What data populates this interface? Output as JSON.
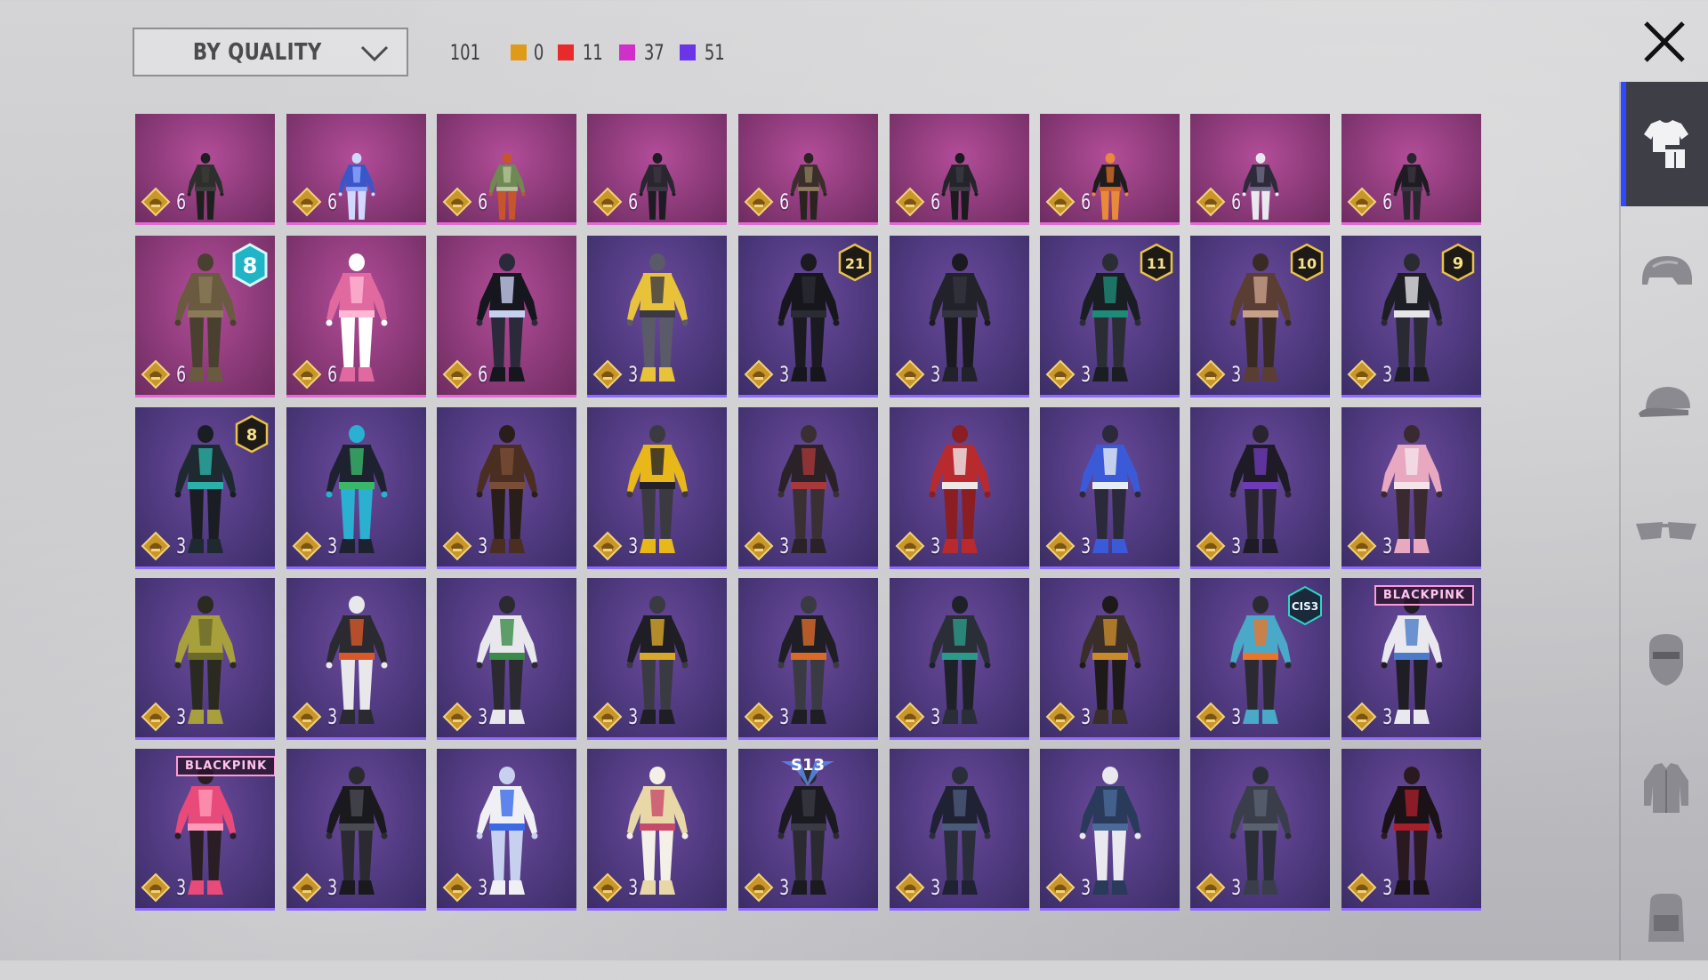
{
  "sort": {
    "label": "BY QUALITY"
  },
  "counts": {
    "total": "101",
    "items": [
      {
        "color": "#e09a1a",
        "value": "0"
      },
      {
        "color": "#e82a2a",
        "value": "11"
      },
      {
        "color": "#d12fc9",
        "value": "37"
      },
      {
        "color": "#6a35e8",
        "value": "51"
      }
    ]
  },
  "sidebar": {
    "items": [
      {
        "name": "outfit",
        "icon": "outfit-icon",
        "active": true
      },
      {
        "name": "helmet",
        "icon": "helmet-icon",
        "active": false
      },
      {
        "name": "cap",
        "icon": "cap-icon",
        "active": false
      },
      {
        "name": "glasses",
        "icon": "glasses-icon",
        "active": false
      },
      {
        "name": "mask",
        "icon": "mask-icon",
        "active": false
      },
      {
        "name": "jacket",
        "icon": "jacket-icon",
        "active": false
      },
      {
        "name": "backpack",
        "icon": "backpack-icon",
        "active": false
      }
    ]
  },
  "grid": {
    "rows": [
      [
        {
          "quality": "pink",
          "price": "6",
          "outfit": "dark-camo"
        },
        {
          "quality": "pink",
          "price": "6",
          "outfit": "blue-dancer"
        },
        {
          "quality": "pink",
          "price": "6",
          "outfit": "green-skirt"
        },
        {
          "quality": "pink",
          "price": "6",
          "outfit": "dark-coat"
        },
        {
          "quality": "pink",
          "price": "6",
          "outfit": "tan-boots"
        },
        {
          "quality": "pink",
          "price": "6",
          "outfit": "suit"
        },
        {
          "quality": "pink",
          "price": "6",
          "outfit": "orange-fox"
        },
        {
          "quality": "pink",
          "price": "6",
          "outfit": "plaid"
        },
        {
          "quality": "pink",
          "price": "6",
          "outfit": "black-trench"
        }
      ],
      [
        {
          "quality": "pink",
          "price": "6",
          "outfit": "camo-soldier",
          "badge": "8",
          "badgeStyle": "teal"
        },
        {
          "quality": "pink",
          "price": "6",
          "outfit": "pink-swim"
        },
        {
          "quality": "pink",
          "price": "6",
          "outfit": "skeleton"
        },
        {
          "quality": "purple",
          "price": "3",
          "outfit": "yellow-top"
        },
        {
          "quality": "purple",
          "price": "3",
          "outfit": "black-armor",
          "badge": "21",
          "badgeStyle": "gold"
        },
        {
          "quality": "purple",
          "price": "3",
          "outfit": "dark-dress"
        },
        {
          "quality": "purple",
          "price": "3",
          "outfit": "teal-ninja",
          "badge": "11",
          "badgeStyle": "gold"
        },
        {
          "quality": "purple",
          "price": "3",
          "outfit": "fur-coat",
          "badge": "10",
          "badgeStyle": "gold"
        },
        {
          "quality": "purple",
          "price": "3",
          "outfit": "black-white",
          "badge": "9",
          "badgeStyle": "gold"
        }
      ],
      [
        {
          "quality": "purple",
          "price": "3",
          "outfit": "teal-stealth",
          "badge": "8",
          "badgeStyle": "gold"
        },
        {
          "quality": "purple",
          "price": "3",
          "outfit": "green-cape"
        },
        {
          "quality": "purple",
          "price": "3",
          "outfit": "brown-hood"
        },
        {
          "quality": "purple",
          "price": "3",
          "outfit": "yellow-jacket"
        },
        {
          "quality": "purple",
          "price": "3",
          "outfit": "red-vest"
        },
        {
          "quality": "purple",
          "price": "3",
          "outfit": "red-white"
        },
        {
          "quality": "purple",
          "price": "3",
          "outfit": "blue-white"
        },
        {
          "quality": "purple",
          "price": "3",
          "outfit": "purple-hood"
        },
        {
          "quality": "purple",
          "price": "3",
          "outfit": "pink-skirt"
        }
      ],
      [
        {
          "quality": "purple",
          "price": "3",
          "outfit": "yellow-tactical"
        },
        {
          "quality": "purple",
          "price": "3",
          "outfit": "orange-racer"
        },
        {
          "quality": "purple",
          "price": "3",
          "outfit": "white-hoodie"
        },
        {
          "quality": "purple",
          "price": "3",
          "outfit": "yellow-black"
        },
        {
          "quality": "purple",
          "price": "3",
          "outfit": "orange-black"
        },
        {
          "quality": "purple",
          "price": "3",
          "outfit": "teal-scarf"
        },
        {
          "quality": "purple",
          "price": "3",
          "outfit": "orange-belt"
        },
        {
          "quality": "purple",
          "price": "3",
          "outfit": "orange-pants",
          "badge": "CIS3",
          "badgeStyle": "hex"
        },
        {
          "quality": "purple",
          "price": "3",
          "outfit": "blackpink-blue",
          "tag": "BLACKPINK"
        }
      ],
      [
        {
          "quality": "purple",
          "price": "3",
          "outfit": "blackpink-pink",
          "tag": "BLACKPINK"
        },
        {
          "quality": "purple",
          "price": "3",
          "outfit": "black-leather"
        },
        {
          "quality": "purple",
          "price": "3",
          "outfit": "white-blue-suit"
        },
        {
          "quality": "purple",
          "price": "3",
          "outfit": "idol-dress"
        },
        {
          "quality": "purple",
          "price": "3",
          "outfit": "s13-leather",
          "badge": "S13",
          "badgeStyle": "wing"
        },
        {
          "quality": "purple",
          "price": "3",
          "outfit": "hooded-navy"
        },
        {
          "quality": "purple",
          "price": "3",
          "outfit": "denim"
        },
        {
          "quality": "purple",
          "price": "3",
          "outfit": "grey-hood"
        },
        {
          "quality": "purple",
          "price": "3",
          "outfit": "red-black-pair"
        }
      ]
    ]
  },
  "palette": {
    "black-white": [
      "#1d1d24",
      "#e6e6ea",
      "#2a2a32"
    ],
    "black-armor": [
      "#16161c",
      "#2b2b34",
      "#1a1a20"
    ],
    "dark-camo": [
      "#2e2f2c",
      "#3a3c38",
      "#1f201e"
    ],
    "blue-dancer": [
      "#3a56c8",
      "#8fa8ff",
      "#d0d8ff"
    ],
    "green-skirt": [
      "#6e8a52",
      "#b5c49a",
      "#c7542a"
    ],
    "dark-coat": [
      "#2a2630",
      "#3b3642",
      "#1e1b22"
    ],
    "tan-boots": [
      "#3a2e2a",
      "#8c7a5a",
      "#2a2320"
    ],
    "suit": [
      "#24242a",
      "#3a3a42",
      "#1a1a1f"
    ],
    "orange-fox": [
      "#1f1c1e",
      "#d46a26",
      "#e88a3a"
    ],
    "plaid": [
      "#2d2a3a",
      "#6e6a86",
      "#e8e8ee"
    ],
    "black-trench": [
      "#1e1c22",
      "#3a3440",
      "#2a2630"
    ],
    "camo-soldier": [
      "#6a5a40",
      "#8a7a58",
      "#4a4030"
    ],
    "pink-swim": [
      "#e06aa0",
      "#ffb8d4",
      "#ffffff"
    ],
    "skeleton": [
      "#16161e",
      "#c8d0f0",
      "#2a2a3a"
    ],
    "yellow-top": [
      "#e8c23a",
      "#3a3a46",
      "#5a5a68"
    ],
    "dark-dress": [
      "#22222a",
      "#34343e",
      "#1a1a20"
    ],
    "teal-ninja": [
      "#1a1e22",
      "#1e8a78",
      "#2a2e34"
    ],
    "fur-coat": [
      "#5a3e34",
      "#c8a08a",
      "#3a2a24"
    ],
    "teal-stealth": [
      "#1e2a30",
      "#2ab0a8",
      "#1a1e24"
    ],
    "green-cape": [
      "#1e2230",
      "#3ab86a",
      "#2ab0d0"
    ],
    "brown-hood": [
      "#4a2e22",
      "#7a4e36",
      "#2a1e1a"
    ],
    "yellow-jacket": [
      "#e8b81a",
      "#222228",
      "#3a3a40"
    ],
    "red-vest": [
      "#2a2226",
      "#a8383a",
      "#3a3034"
    ],
    "red-white": [
      "#b82a2e",
      "#f0e8e8",
      "#8a1e22"
    ],
    "blue-white": [
      "#3a5ad8",
      "#e8ecf4",
      "#2a2a3a"
    ],
    "purple-hood": [
      "#1e1a26",
      "#6e3ab8",
      "#2a2430"
    ],
    "pink-skirt": [
      "#e8a8c0",
      "#f4e4ea",
      "#3a2a30"
    ],
    "yellow-tactical": [
      "#a8a03a",
      "#6a6a2a",
      "#2a2a20"
    ],
    "orange-racer": [
      "#2a2a30",
      "#d8582a",
      "#e8e8ea"
    ],
    "white-hoodie": [
      "#e8e8ec",
      "#3a8a4a",
      "#2a2a30"
    ],
    "yellow-black": [
      "#1e1e24",
      "#d8a82a",
      "#3a3a42"
    ],
    "orange-black": [
      "#1e1e24",
      "#d86a2a",
      "#3a3a42"
    ],
    "teal-scarf": [
      "#2a2e36",
      "#2a9a8a",
      "#1e2228"
    ],
    "orange-belt": [
      "#3a2e28",
      "#c88a2a",
      "#1e1a1a"
    ],
    "orange-pants": [
      "#4aa8c8",
      "#e8762a",
      "#2a2a30"
    ],
    "blackpink-blue": [
      "#e8e8ee",
      "#4a7ac8",
      "#1e1e24"
    ],
    "blackpink-pink": [
      "#e84a7a",
      "#ff9ab8",
      "#2a1e24"
    ],
    "black-leather": [
      "#1a1a1e",
      "#4a4a52",
      "#2a2a30"
    ],
    "white-blue-suit": [
      "#f0f0f4",
      "#3a6ae8",
      "#c8d0f0"
    ],
    "idol-dress": [
      "#e8d8a8",
      "#c84a6a",
      "#f4f0e8"
    ],
    "s13-leather": [
      "#1a1a20",
      "#3a3a44",
      "#2a2a30"
    ],
    "hooded-navy": [
      "#1e2232",
      "#4a5a7a",
      "#2a2e3a"
    ],
    "denim": [
      "#2a3a5a",
      "#4a6a9a",
      "#e8e8ee"
    ],
    "grey-hood": [
      "#3a3e4a",
      "#5a6270",
      "#2a2e36"
    ],
    "red-black-pair": [
      "#1a1216",
      "#a81e2a",
      "#2a1a20"
    ]
  }
}
